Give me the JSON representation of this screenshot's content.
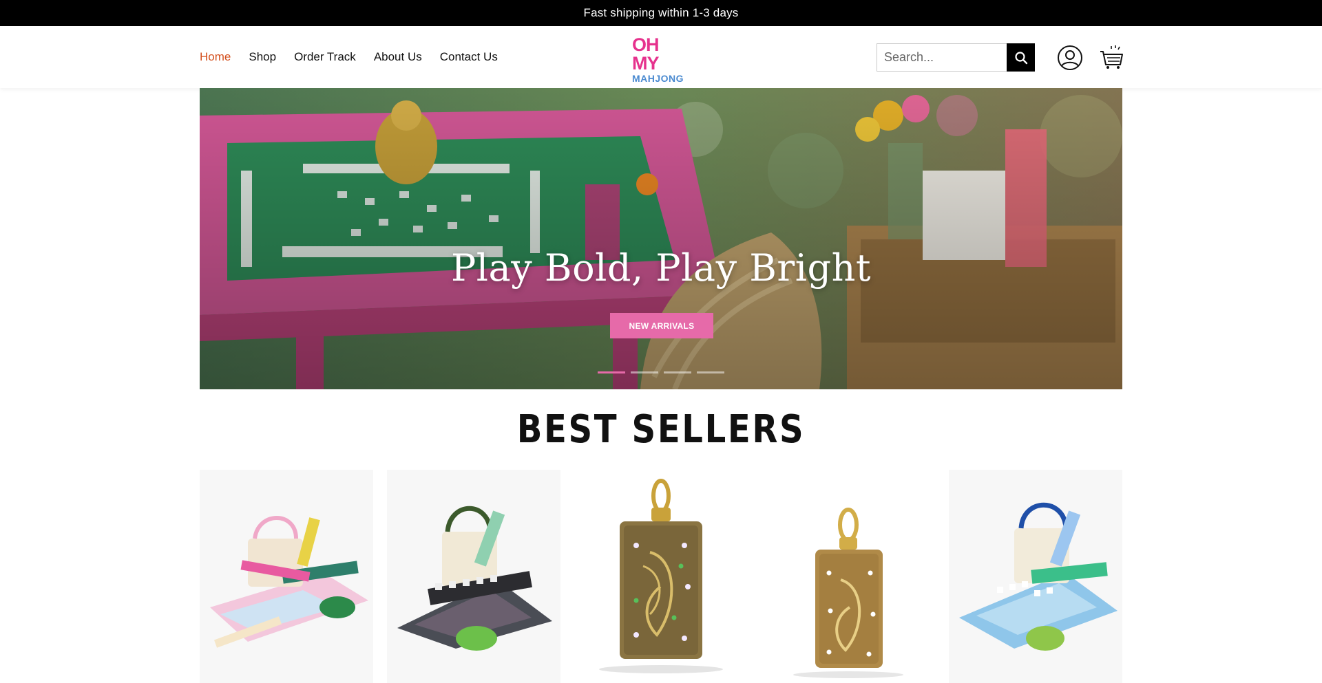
{
  "announcement": {
    "text": "Fast shipping within 1-3 days"
  },
  "nav": {
    "items": [
      {
        "label": "Home",
        "active": true
      },
      {
        "label": "Shop",
        "active": false
      },
      {
        "label": "Order Track",
        "active": false
      },
      {
        "label": "About Us",
        "active": false
      },
      {
        "label": "Contact Us",
        "active": false
      }
    ]
  },
  "logo": {
    "line1": "OH",
    "line2": "MY",
    "line3": "MAHJONG"
  },
  "search": {
    "placeholder": "Search...",
    "value": ""
  },
  "icons": {
    "search": "search-icon",
    "account": "user-circle-icon",
    "cart": "shopping-cart-icon"
  },
  "hero": {
    "headline": "Play Bold, Play Bright",
    "cta_label": "NEW ARRIVALS",
    "slide_count": 4,
    "active_slide": 1
  },
  "best_sellers": {
    "title": "BEST SELLERS",
    "products": [
      {
        "image": "pastel mahjong set with tote and mat"
      },
      {
        "image": "dark mahjong set with tote and mat"
      },
      {
        "image": "gold tile pendant with colored gems"
      },
      {
        "image": "gold tile pendant with white gems"
      },
      {
        "image": "blue mahjong set with tote and mat"
      }
    ]
  },
  "colors": {
    "accent": "#d4501e",
    "brand_pink": "#e66aa9",
    "logo_pink": "#e6328d",
    "logo_blue": "#4a8ad0"
  }
}
